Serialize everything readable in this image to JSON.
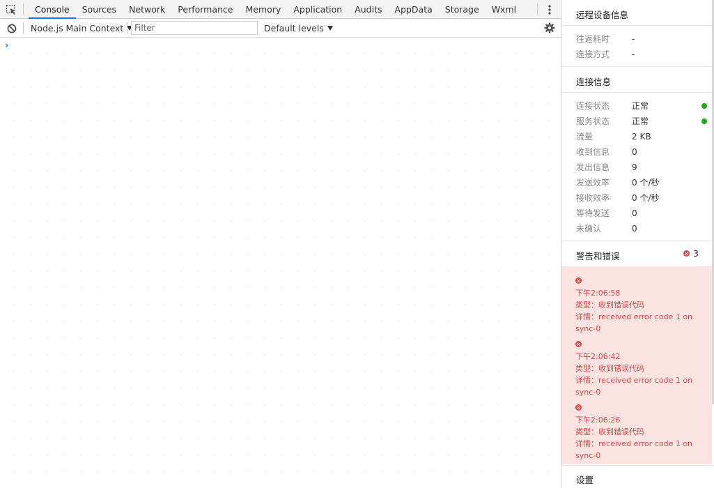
{
  "devtools": {
    "tabs": [
      "Console",
      "Sources",
      "Network",
      "Performance",
      "Memory",
      "Application",
      "Audits",
      "AppData",
      "Storage",
      "Wxml"
    ],
    "active_tab": "Console",
    "toolbar": {
      "context": "Node.js Main Context",
      "filter_placeholder": "Filter",
      "levels": "Default levels"
    },
    "console": {
      "prompt": "›"
    }
  },
  "panel": {
    "remote_title": "远程设备信息",
    "remote_rows": [
      {
        "label": "往返耗时",
        "value": "-"
      },
      {
        "label": "连接方式",
        "value": "-"
      }
    ],
    "conn_title": "连接信息",
    "conn_rows": [
      {
        "label": "连接状态",
        "value": "正常",
        "status": "green"
      },
      {
        "label": "服务状态",
        "value": "正常",
        "status": "green"
      },
      {
        "label": "流量",
        "value": "2 KB"
      },
      {
        "label": "收到信息",
        "value": "0"
      },
      {
        "label": "发出信息",
        "value": "9"
      },
      {
        "label": "发送效率",
        "value": "0 个/秒"
      },
      {
        "label": "接收效率",
        "value": "0 个/秒"
      },
      {
        "label": "等待发送",
        "value": "0"
      },
      {
        "label": "未确认",
        "value": "0"
      }
    ],
    "warn_title": "警告和错误",
    "error_count": "3",
    "errors": [
      {
        "time": "下午2:06:58",
        "type": "类型：收到错误代码",
        "detail": "详情：received error code 1 on sync-0"
      },
      {
        "time": "下午2:06:42",
        "type": "类型：收到错误代码",
        "detail": "详情：received error code 1 on sync-0"
      },
      {
        "time": "下午2:06:26",
        "type": "类型：收到错误代码",
        "detail": "详情：received error code 1 on sync-0"
      }
    ],
    "settings_title": "设置"
  },
  "colors": {
    "accent": "#1a73e8",
    "ok": "#1aad19",
    "error": "#e64340",
    "error_bg": "#fbe3e2"
  }
}
